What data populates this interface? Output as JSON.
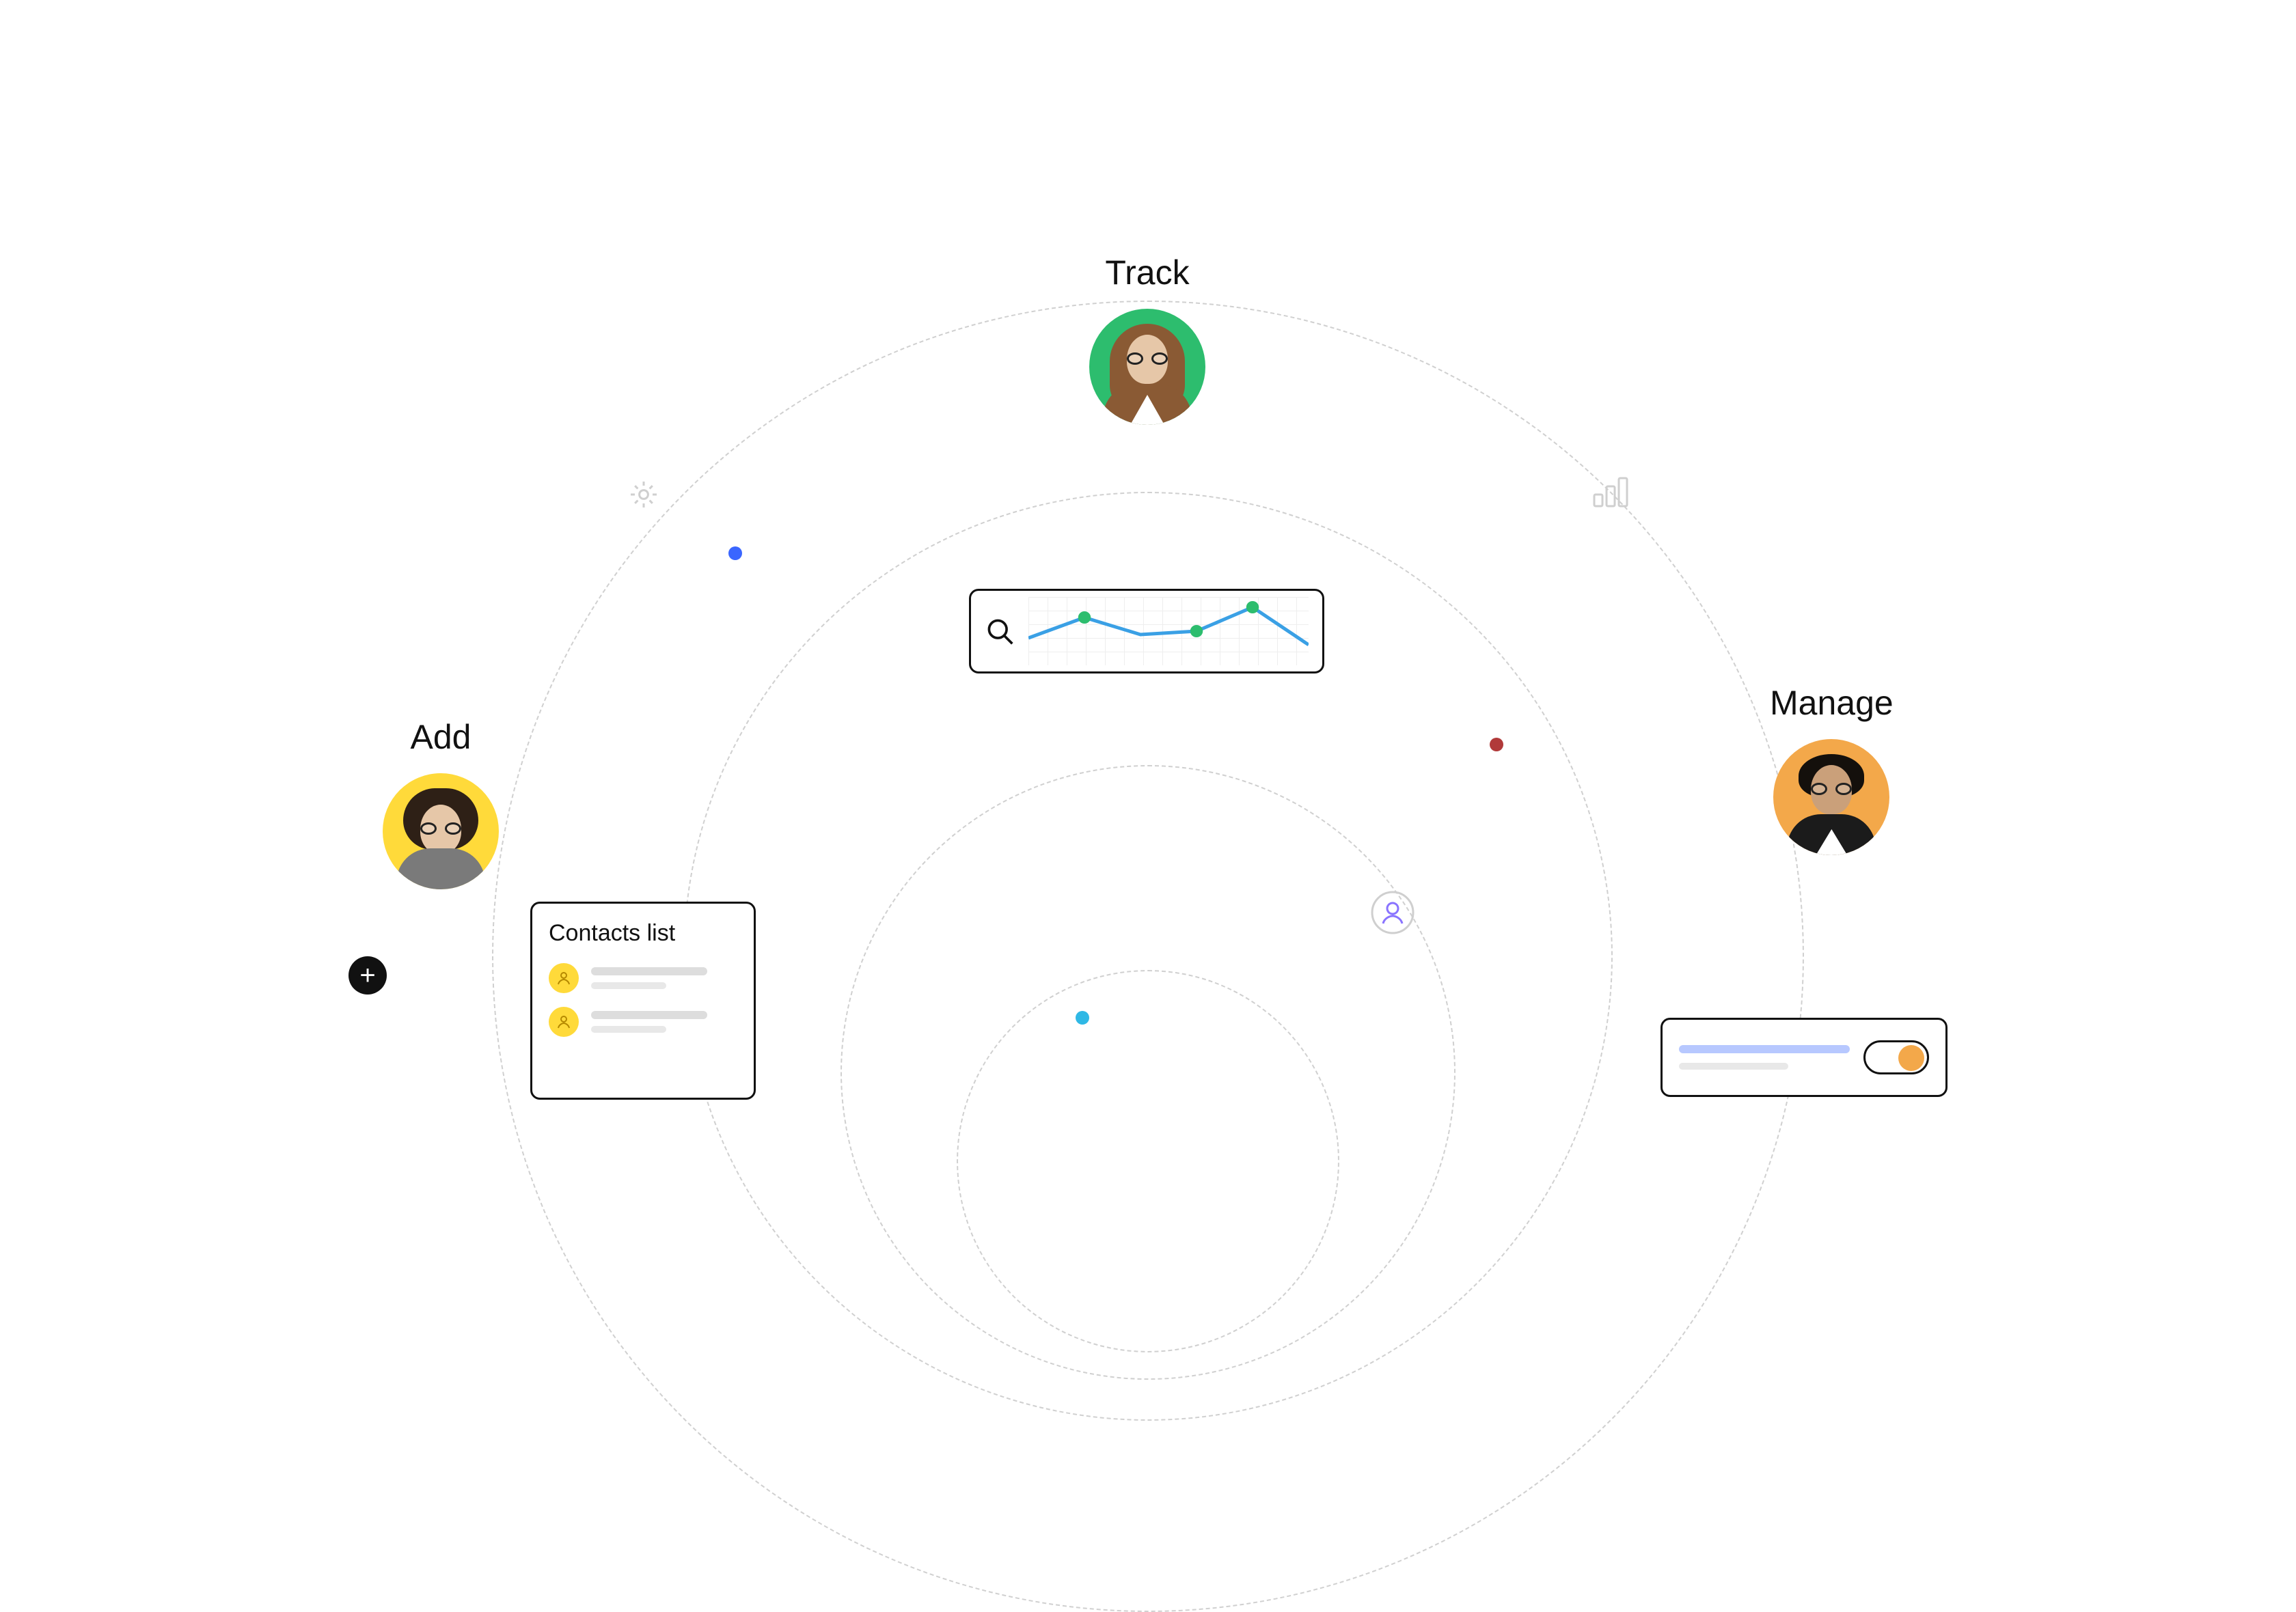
{
  "labels": {
    "track": "Track",
    "add": "Add",
    "manage": "Manage"
  },
  "cards": {
    "contacts_title": "Contacts list"
  },
  "icons": {
    "gear": "gear-icon",
    "bars": "bar-chart-icon",
    "user": "user-icon",
    "search": "search-icon",
    "plus": "plus-icon",
    "person_small": "person-icon",
    "toggle": "toggle-icon"
  },
  "colors": {
    "green": "#2dbd6e",
    "yellow": "#ffda3a",
    "orange": "#f3a84a",
    "line_blue": "#3aa0e5",
    "dot_green": "#2dbd6e",
    "orbit_blue": "#3a66ff",
    "orbit_red": "#b13a3a",
    "orbit_cyan": "#2fb8e5"
  },
  "chart_data": {
    "type": "line",
    "title": "",
    "xlabel": "",
    "ylabel": "",
    "x": [
      0,
      1,
      2,
      3,
      4,
      5
    ],
    "values": [
      40,
      70,
      45,
      50,
      85,
      30
    ],
    "ylim": [
      0,
      100
    ],
    "markers_at": [
      1,
      3,
      4
    ],
    "marker_color": "#2dbd6e",
    "line_color": "#3aa0e5"
  }
}
